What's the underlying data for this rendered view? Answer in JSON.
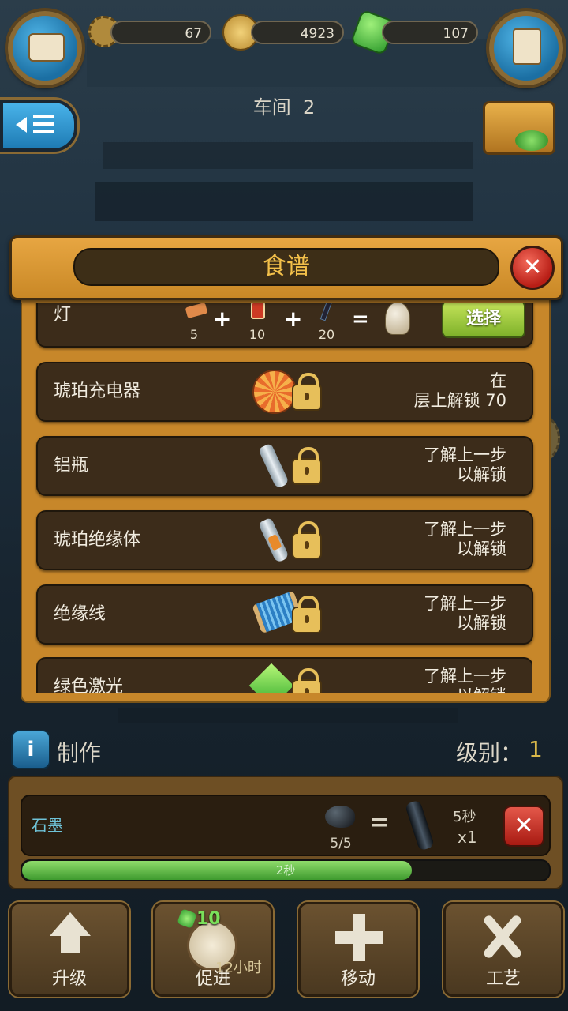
{
  "top": {
    "gears_count": "67",
    "coins_count": "4923",
    "gems_count": "107",
    "workshop_label": "车间",
    "workshop_number": "2"
  },
  "recipe_panel": {
    "title": "食谱",
    "first_row": {
      "name": "灯",
      "ingredients": [
        {
          "icon": "copper-ingot-icon",
          "qty": "5"
        },
        {
          "icon": "spool-icon",
          "qty": "10"
        },
        {
          "icon": "graphite-rod-icon",
          "qty": "20"
        }
      ],
      "result_icon": "light-bulb-icon",
      "select_label": "选择"
    },
    "rows": [
      {
        "name": "琥珀充电器",
        "icon": "amber-charger-icon",
        "status_line1": "在",
        "status_line2": "层上解锁 70"
      },
      {
        "name": "铝瓶",
        "icon": "aluminum-bottle-icon",
        "status_line1": "了解上一步",
        "status_line2": "以解锁"
      },
      {
        "name": "琥珀绝缘体",
        "icon": "amber-insulator-icon",
        "status_line1": "了解上一步",
        "status_line2": "以解锁"
      },
      {
        "name": "绝缘线",
        "icon": "insulated-wire-icon",
        "status_line1": "了解上一步",
        "status_line2": "以解锁"
      },
      {
        "name": "绿色激光",
        "icon": "green-laser-icon",
        "status_line1": "了解上一步",
        "status_line2": "以解锁"
      }
    ]
  },
  "craft": {
    "section_label": "制作",
    "level_label": "级别：",
    "level_value": "1",
    "item_name": "石墨",
    "input_count": "5/5",
    "time": "5秒",
    "multiplier": "x1",
    "progress_text": "2秒",
    "progress_fraction": 0.74
  },
  "bottom_bar": {
    "upgrade_label": "升级",
    "boost_label": "促进",
    "boost_gems": "10",
    "boost_time": "12小时",
    "move_label": "移动",
    "craft_label": "工艺"
  },
  "colors": {
    "panel": "#c7872a",
    "row": "#3c2c1a",
    "accent_blue": "#2d8fcf",
    "progress_green": "#5bbb3f",
    "title_gold": "#f3c04a"
  }
}
